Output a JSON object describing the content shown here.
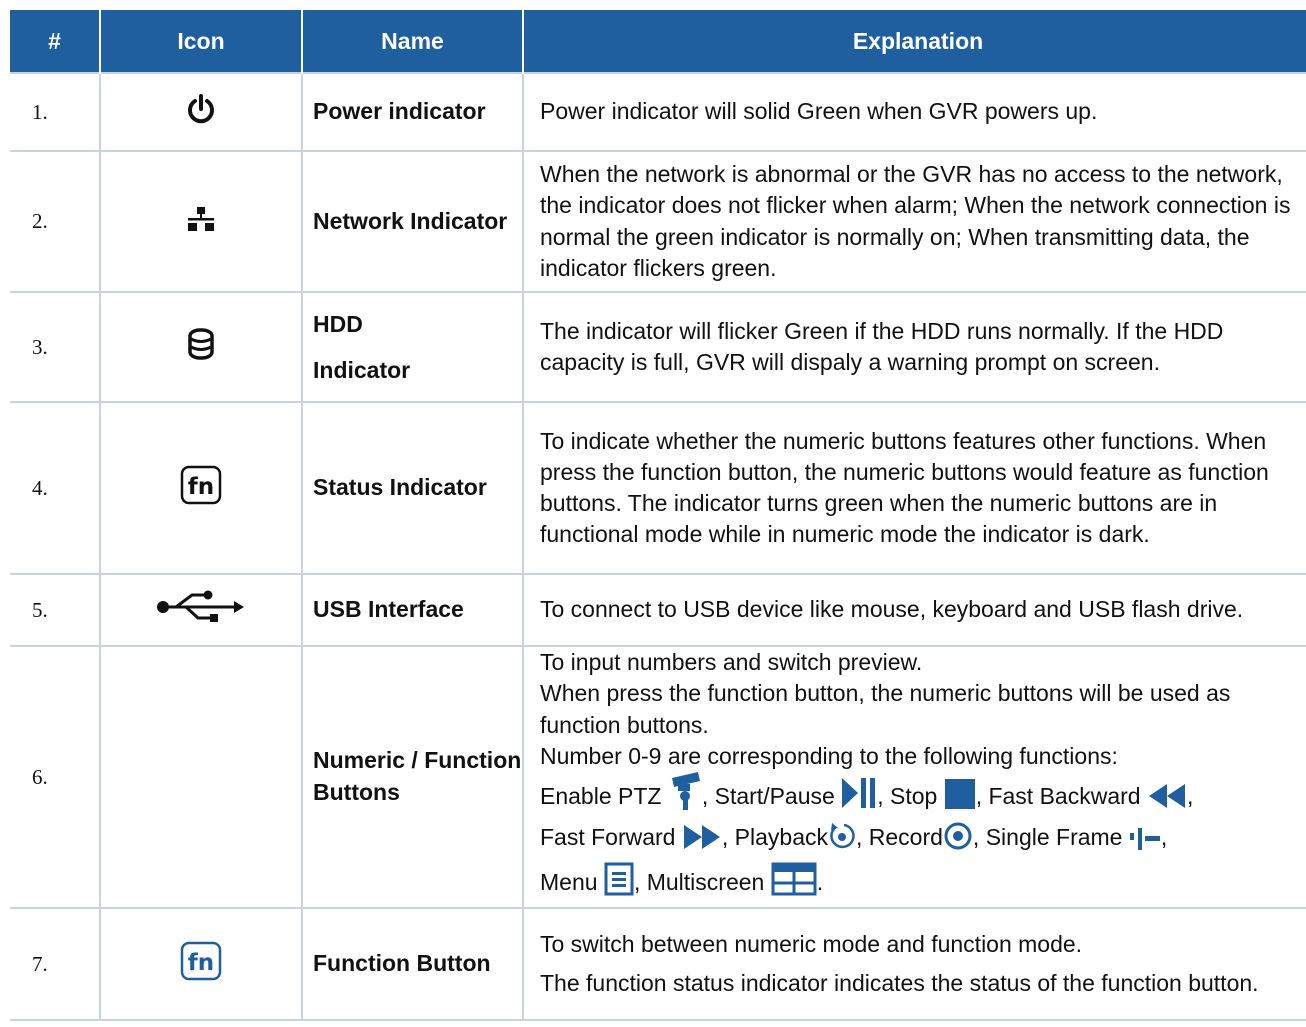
{
  "table": {
    "headers": [
      "#",
      "Icon",
      "Name",
      "Explanation"
    ],
    "rows": [
      {
        "num": "1.",
        "icon": "power-icon",
        "name": "Power indicator",
        "explanation": [
          "Power indicator will solid Green when GVR powers up."
        ]
      },
      {
        "num": "2.",
        "icon": "network-icon",
        "name": "Network Indicator",
        "explanation": [
          "When the network is abnormal or the GVR has no access to the network, the indicator does not flicker when alarm; When the network connection is normal the green indicator is normally on; When transmitting data, the indicator flickers green."
        ]
      },
      {
        "num": "3.",
        "icon": "hdd-icon",
        "name_line1": "HDD",
        "name_line2": "Indicator",
        "explanation": [
          "The indicator will flicker Green if the HDD runs normally. If the HDD capacity is full, GVR will dispaly a warning prompt on screen."
        ]
      },
      {
        "num": "4.",
        "icon": "fn-icon",
        "name": "Status Indicator",
        "explanation": [
          "To indicate whether the numeric buttons features other functions. When press the function button, the numeric buttons would feature as function buttons. The indicator turns green when the numeric buttons are in functional mode while in numeric mode the indicator is dark."
        ]
      },
      {
        "num": "5.",
        "icon": "usb-icon",
        "name": "USB Interface",
        "explanation": [
          "To connect to USB device like mouse, keyboard and USB flash drive."
        ]
      },
      {
        "num": "6.",
        "name": "Numeric / Function Buttons",
        "explanation": [
          "To input numbers and switch preview.",
          "When press the function button, the numeric buttons will be used as function buttons.",
          "Number 0-9 are corresponding to the following functions:"
        ],
        "functions": {
          "enable_ptz": "Enable PTZ",
          "start_pause": ", Start/Pause ",
          "stop": ", Stop ",
          "fast_backward": ", Fast Backward ",
          "fast_forward": "Fast Forward ",
          "playback": ", Playback",
          "record": ", Record",
          "single_frame": ", Single Frame ",
          "menu": "Menu ",
          "multiscreen": ", Multiscreen ",
          "end": "."
        }
      },
      {
        "num": "7.",
        "icon": "fn-icon",
        "name": "Function Button",
        "explanation": [
          "To switch between numeric mode and function mode.",
          "The function status indicator indicates the status of the function button."
        ]
      }
    ]
  },
  "colors": {
    "header_bg": "#1f5fa0",
    "header_text": "#ffffff",
    "icon_blue": "#1f5fa0",
    "grid": "#c9d3de"
  }
}
